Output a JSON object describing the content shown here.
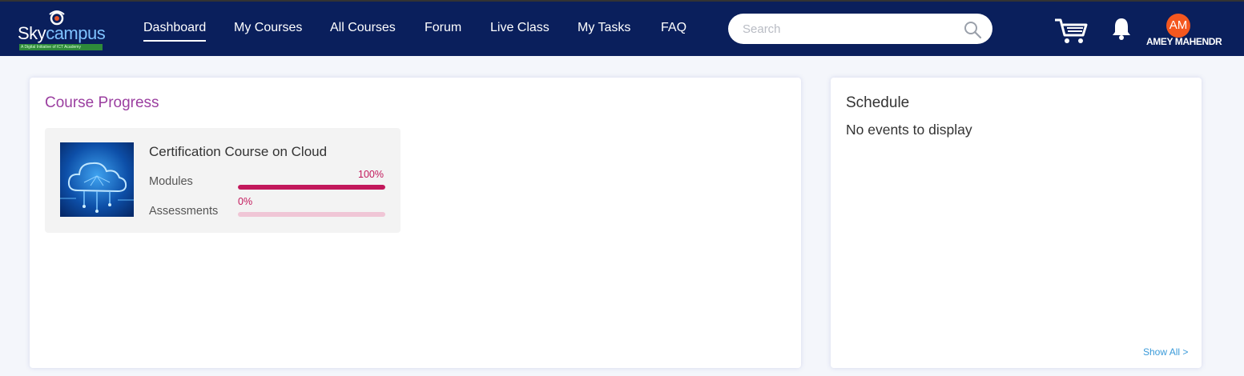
{
  "brand": {
    "name_a": "Sky",
    "name_b": "campus",
    "tagline": "A Digital Initiative of ICT Academy"
  },
  "nav": {
    "dashboard": "Dashboard",
    "my_courses": "My Courses",
    "all_courses": "All Courses",
    "forum": "Forum",
    "live_class": "Live Class",
    "my_tasks": "My Tasks",
    "faq": "FAQ"
  },
  "search": {
    "placeholder": "Search",
    "value": ""
  },
  "user": {
    "initials": "AM",
    "name": "AMEY MAHENDR"
  },
  "course_progress": {
    "title": "Course Progress",
    "courses": [
      {
        "name": "Certification Course on Cloud",
        "modules_label": "Modules",
        "modules_pct_text": "100%",
        "modules_progress": 100,
        "assessments_label": "Assessments",
        "assessments_pct_text": "0%",
        "assessments_progress": 0
      }
    ]
  },
  "schedule": {
    "title": "Schedule",
    "empty_text": "No events to display",
    "show_all": "Show All >"
  },
  "colors": {
    "navbar": "#0a1f5c",
    "accent_purple": "#9b3fa0",
    "progress": "#c2185b",
    "progress_track": "#f0c6d6",
    "avatar": "#f4571f",
    "link": "#3a9ad9"
  }
}
